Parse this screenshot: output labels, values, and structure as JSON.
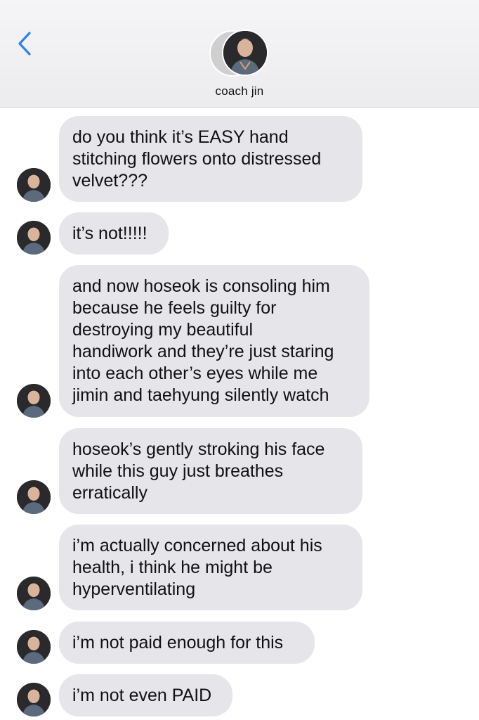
{
  "header": {
    "contact_name": "coach jin",
    "back_icon": "chevron-left-icon",
    "accent_color": "#2f80ed"
  },
  "messages": [
    {
      "lines": [
        "do you think it’s EASY hand",
        "stitching flowers onto distressed",
        "velvet???"
      ]
    },
    {
      "lines": [
        "it’s not!!!!!"
      ]
    },
    {
      "lines": [
        "and now hoseok is consoling him",
        "because he feels guilty for",
        "destroying my beautiful",
        "handiwork and they’re just staring",
        "into each other’s eyes while me",
        "jimin and taehyung silently watch"
      ]
    },
    {
      "lines": [
        "hoseok’s gently stroking his face",
        "while this guy just breathes",
        "erratically"
      ]
    },
    {
      "lines": [
        "i’m actually concerned about his",
        "health, i think he might be",
        "hyperventilating"
      ]
    },
    {
      "lines": [
        "i’m not paid enough for this"
      ]
    },
    {
      "lines": [
        "i’m not even PAID"
      ]
    }
  ],
  "colors": {
    "bubble_received": "#e5e5ea",
    "text": "#111111"
  }
}
